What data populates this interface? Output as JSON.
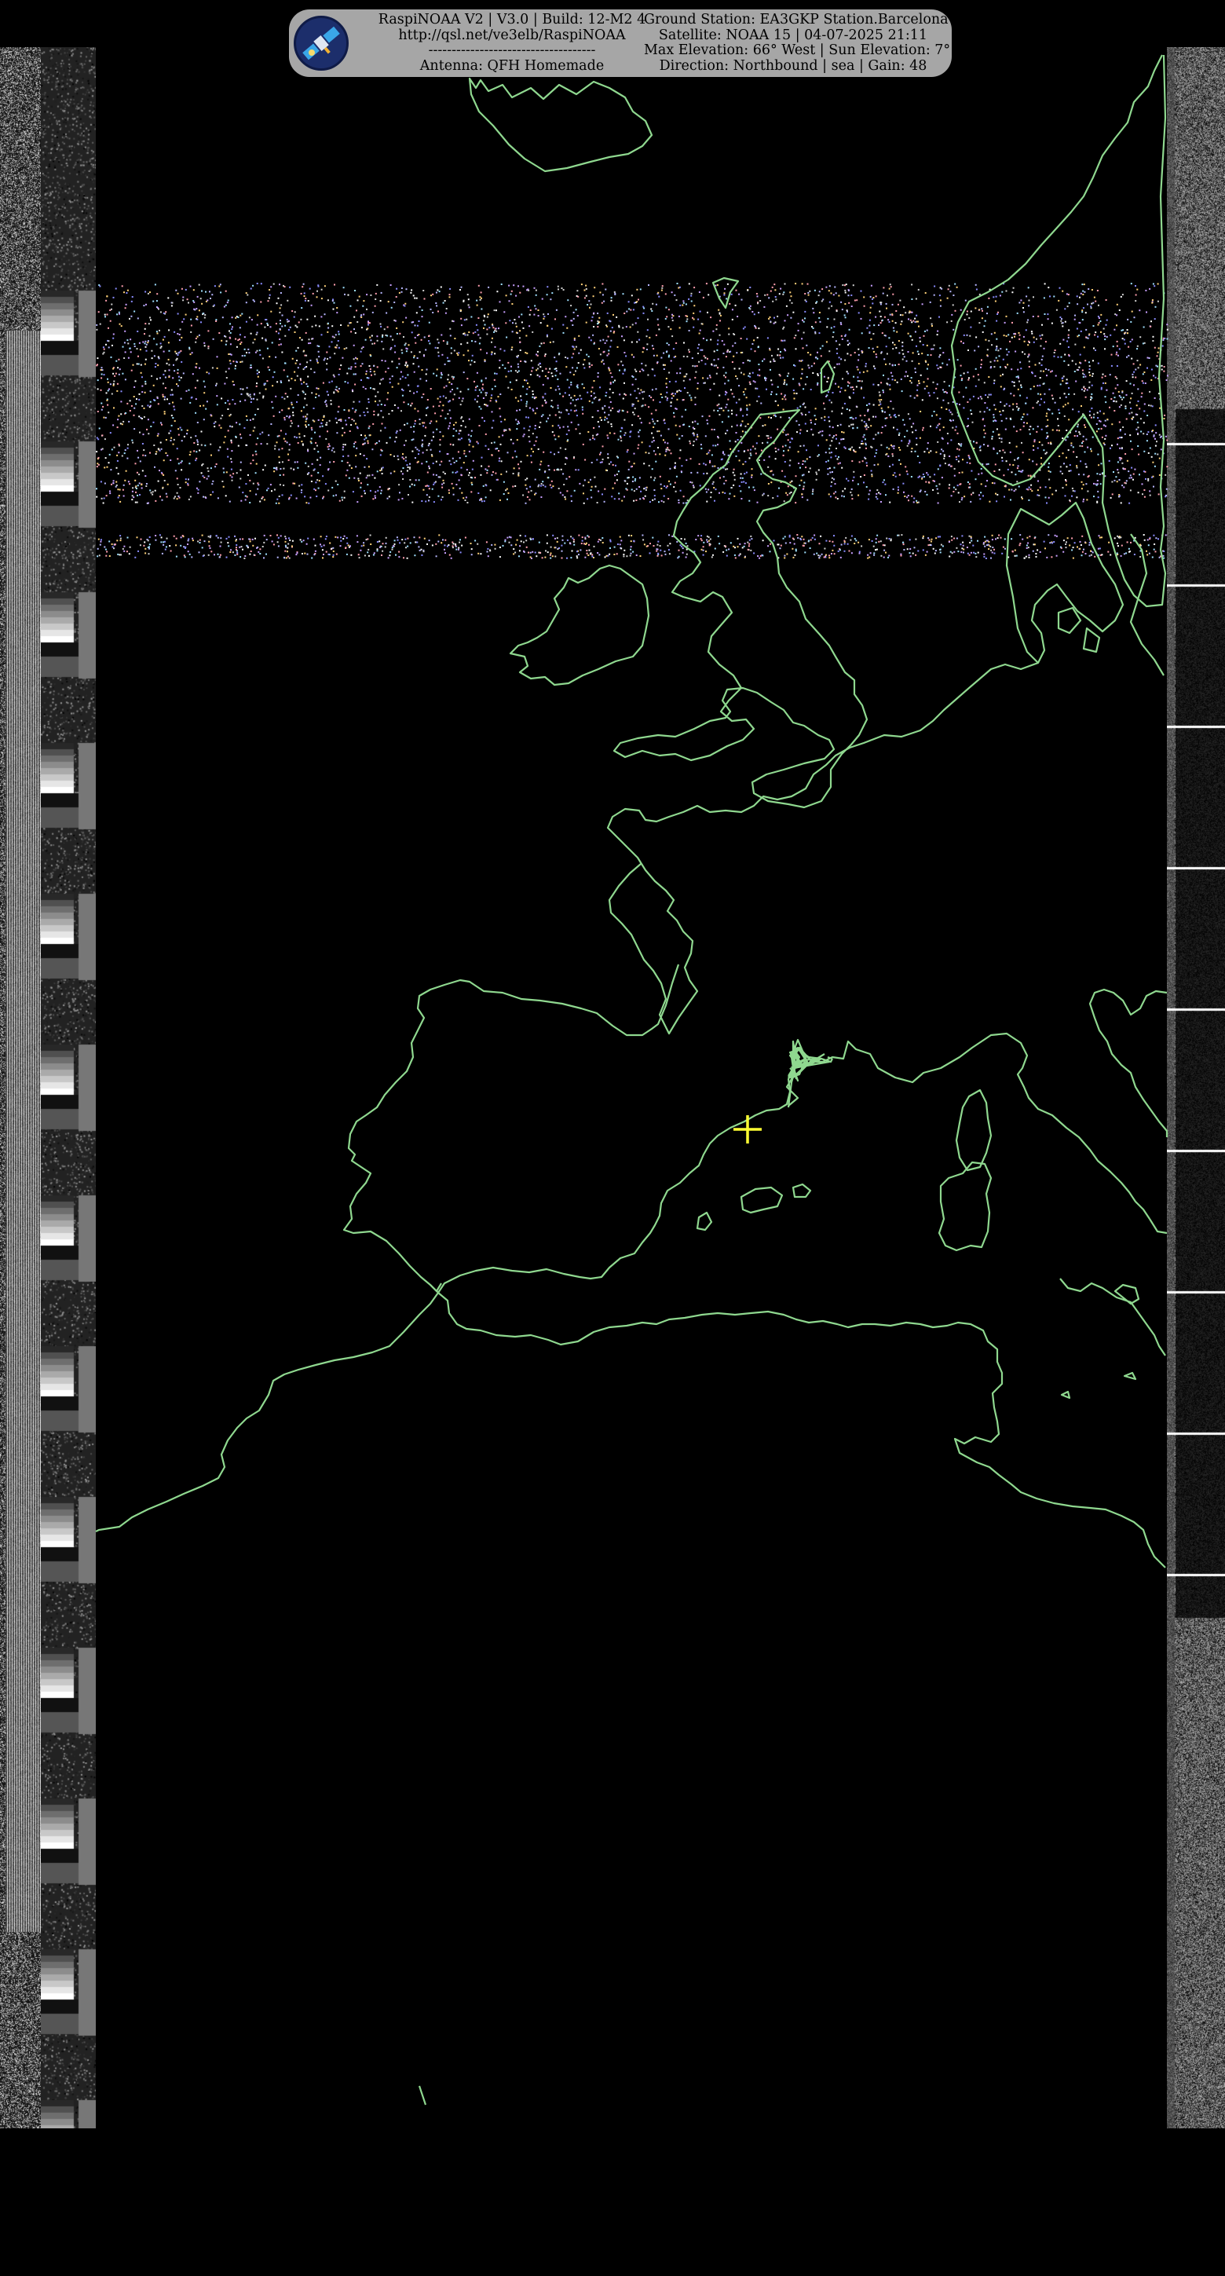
{
  "header": {
    "left_lines": [
      "RaspiNOAA V2 | V3.0 | Build: 12-M2 4",
      "http://qsl.net/ve3elb/RaspiNOAA",
      "------------------------------------",
      "Antenna: QFH Homemade"
    ],
    "right_lines": [
      "Ground Station: EA3GKP Station.Barcelona",
      "Satellite: NOAA 15 | 04-07-2025 21:11",
      "Max Elevation: 66° West | Sun Elevation: 7°",
      "Direction: Northbound | sea | Gain: 48"
    ]
  },
  "colors": {
    "background": "#000000",
    "coastline": "#8fd88f",
    "marker": "#ffff33",
    "header_bg": "#a6a6a6"
  },
  "icons": {
    "logo": "satellite-logo-icon",
    "marker": "ground-station-crosshair-icon"
  }
}
